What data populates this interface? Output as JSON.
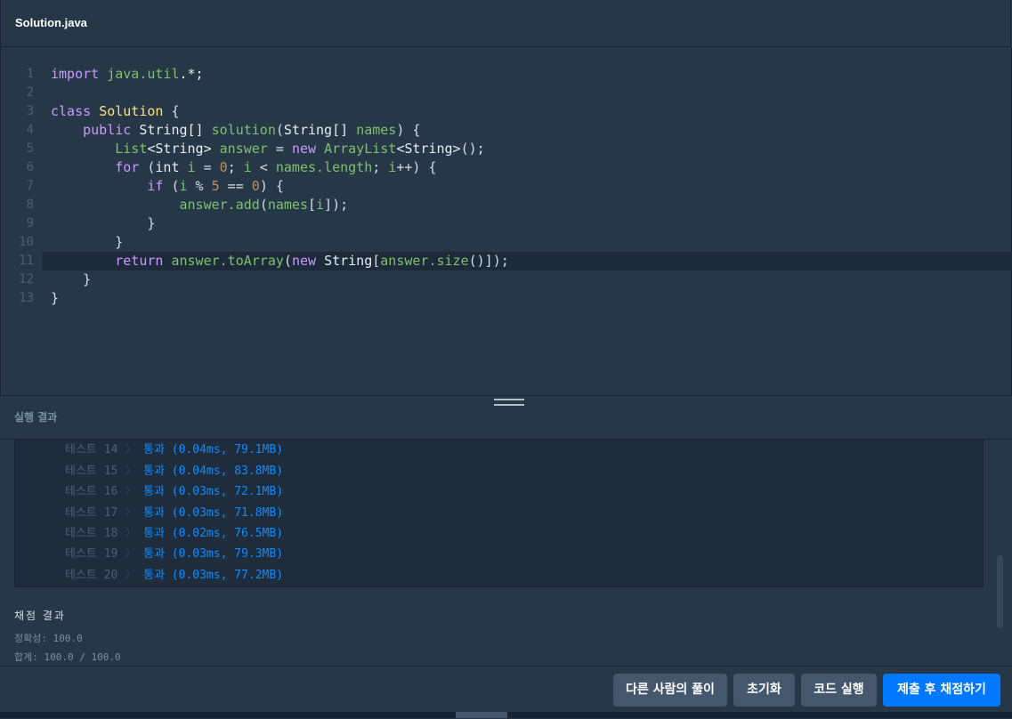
{
  "header": {
    "filename": "Solution.java"
  },
  "code": {
    "lines": [
      {
        "n": "1"
      },
      {
        "n": "2"
      },
      {
        "n": "3"
      },
      {
        "n": "4"
      },
      {
        "n": "5"
      },
      {
        "n": "6"
      },
      {
        "n": "7"
      },
      {
        "n": "8"
      },
      {
        "n": "9"
      },
      {
        "n": "10"
      },
      {
        "n": "11"
      },
      {
        "n": "12"
      },
      {
        "n": "13"
      }
    ],
    "text": {
      "import_kw": "import",
      "import_path": "java.util",
      "import_tail": ".*;",
      "class_kw": "class",
      "class_name": "Solution",
      "public_kw": "public",
      "ret_type": "String[]",
      "method_name": "solution",
      "param_type": "String[]",
      "param_name": "names",
      "list_type": "List",
      "generic1": "<String>",
      "var_answer": "answer",
      "new_kw": "new",
      "arraylist": "ArrayList",
      "generic2": "<String>",
      "for_kw": "for",
      "int_kw": "int",
      "var_i": "i",
      "zero": "0",
      "names_length": "names.length",
      "if_kw": "if",
      "five": "5",
      "answer_add": "answer.add",
      "names_ref": "names",
      "return_kw": "return",
      "answer_toarray": "answer.toArray",
      "string_type": "String",
      "answer_size": "answer.size"
    },
    "active_line": "11"
  },
  "result": {
    "title": "실행 결과",
    "tests": [
      {
        "label": "테스트 14",
        "result": "통과 (0.04ms, 79.1MB)"
      },
      {
        "label": "테스트 15",
        "result": "통과 (0.04ms, 83.8MB)"
      },
      {
        "label": "테스트 16",
        "result": "통과 (0.03ms, 72.1MB)"
      },
      {
        "label": "테스트 17",
        "result": "통과 (0.03ms, 71.8MB)"
      },
      {
        "label": "테스트 18",
        "result": "통과 (0.02ms, 76.5MB)"
      },
      {
        "label": "테스트 19",
        "result": "통과 (0.03ms, 79.3MB)"
      },
      {
        "label": "테스트 20",
        "result": "통과 (0.03ms, 77.2MB)"
      }
    ],
    "chevron": "〉",
    "score_title": "채점 결과",
    "accuracy": "정확성: 100.0",
    "total": "합계: 100.0 / 100.0"
  },
  "footer": {
    "others_label": "다른 사람의 풀이",
    "reset_label": "초기화",
    "run_label": "코드 실행",
    "submit_label": "제출 후 채점하기"
  },
  "colors": {
    "background": "#263747",
    "primary_button": "#0078ff",
    "secondary_button": "#44576c",
    "pass_text": "#0a8cff"
  }
}
